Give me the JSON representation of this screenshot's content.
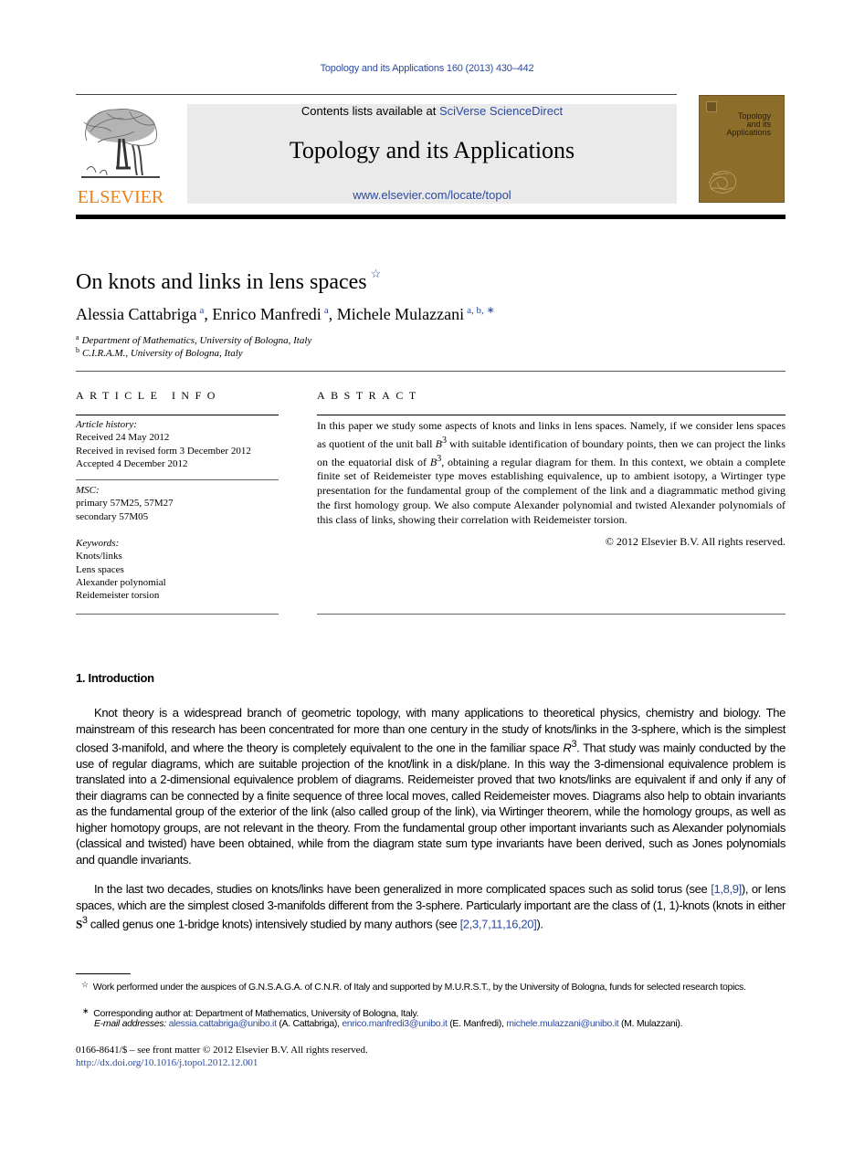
{
  "header": {
    "journal_reference": "Topology and its Applications 160 (2013) 430–442",
    "contents_prefix": "Contents lists available at ",
    "contents_link": "SciVerse ScienceDirect",
    "journal_title": "Topology and its Applications",
    "journal_url": "www.elsevier.com/locate/topol",
    "publisher_logo_text": "ELSEVIER",
    "cover_title_lines": [
      "Topology",
      "and its",
      "Applications"
    ],
    "colors": {
      "link": "#2b4a9f",
      "elsevier_orange": "#f07f1a",
      "cover": "#8c6d2a",
      "masthead_bg": "#eaeaea"
    }
  },
  "article": {
    "title": "On knots and links in lens spaces",
    "title_note_mark": "☆",
    "authors": [
      {
        "name": "Alessia Cattabriga",
        "affil": "a"
      },
      {
        "name": "Enrico Manfredi",
        "affil": "a"
      },
      {
        "name": "Michele Mulazzani",
        "affil": "a, b, ∗"
      }
    ],
    "author_separator": ", ",
    "affiliations": [
      {
        "mark": "a",
        "text": "Department of Mathematics, University of Bologna, Italy"
      },
      {
        "mark": "b",
        "text": "C.I.R.A.M., University of Bologna, Italy"
      }
    ]
  },
  "article_info": {
    "heading": "ARTICLE INFO",
    "history_label": "Article history:",
    "history": [
      "Received 24 May 2012",
      "Received in revised form 3 December 2012",
      "Accepted 4 December 2012"
    ],
    "msc_label": "MSC:",
    "msc": [
      "primary 57M25, 57M27",
      "secondary 57M05"
    ],
    "keywords_label": "Keywords:",
    "keywords": [
      "Knots/links",
      "Lens spaces",
      "Alexander polynomial",
      "Reidemeister torsion"
    ]
  },
  "abstract": {
    "heading": "ABSTRACT",
    "text_1": "In this paper we study some aspects of knots and links in lens spaces. Namely, if we consider lens spaces as quotient of the unit ball ",
    "math_B": "B",
    "math_exp": "3",
    "text_2": " with suitable identification of boundary points, then we can project the links on the equatorial disk of ",
    "text_3": ", obtaining a regular diagram for them. In this context, we obtain a complete finite set of Reidemeister type moves establishing equivalence, up to ambient isotopy, a Wirtinger type presentation for the fundamental group of the complement of the link and a diagrammatic method giving the first homology group. We also compute Alexander polynomial and twisted Alexander polynomials of this class of links, showing their correlation with Reidemeister torsion.",
    "copyright": "© 2012 Elsevier B.V. All rights reserved."
  },
  "introduction": {
    "heading": "1. Introduction",
    "para1_a": "Knot theory is a widespread branch of geometric topology, with many applications to theoretical physics, chemistry and biology. The mainstream of this research has been concentrated for more than one century in the study of knots/links in the 3-sphere, which is the simplest closed 3-manifold, and where the theory is completely equivalent to the one in the familiar space ",
    "para1_R": "R",
    "para1_exp": "3",
    "para1_b": ". That study was mainly conducted by the use of regular diagrams, which are suitable projection of the knot/link in a disk/plane. In this way the 3-dimensional equivalence problem is translated into a 2-dimensional equivalence problem of diagrams. Reidemeister proved that two knots/links are equivalent if and only if any of their diagrams can be connected by a finite sequence of three local moves, called Reidemeister moves. Diagrams also help to obtain invariants as the fundamental group of the exterior of the link (also called group of the link), via Wirtinger theorem, while the homology groups, as well as higher homotopy groups, are not relevant in the theory. From the fundamental group other important invariants such as Alexander polynomials (classical and twisted) have been obtained, while from the diagram state sum type invariants have been derived, such as Jones polynomials and quandle invariants.",
    "para2_a": "In the last two decades, studies on knots/links have been generalized in more complicated spaces such as solid torus (see ",
    "para2_ref1": "[1,8,9]",
    "para2_b": "), or lens spaces, which are the simplest closed 3-manifolds different from the 3-sphere. Particularly important are the class of (1, 1)-knots (knots in either ",
    "para2_S": "S",
    "para2_exp": "3",
    "para2_c": " called genus one 1-bridge knots) intensively studied by many authors (see ",
    "para2_ref2": "[2,3,7,11,16,20]",
    "para2_d": ")."
  },
  "footnotes": {
    "star_mark": "☆",
    "star_text": "Work performed under the auspices of G.N.S.A.G.A. of C.N.R. of Italy and supported by M.U.R.S.T., by the University of Bologna, funds for selected research topics.",
    "corr_mark": "∗",
    "corr_text": "Corresponding author at: Department of Mathematics, University of Bologna, Italy.",
    "email_label": "E-mail addresses:",
    "emails": [
      {
        "address": "alessia.cattabriga@unibo.it",
        "name": "(A. Cattabriga)"
      },
      {
        "address": "enrico.manfredi3@unibo.it",
        "name": "(E. Manfredi)"
      },
      {
        "address": "michele.mulazzani@unibo.it",
        "name": "(M. Mulazzani)."
      }
    ]
  },
  "footer": {
    "front_matter": "0166-8641/$ – see front matter © 2012 Elsevier B.V. All rights reserved.",
    "doi": "http://dx.doi.org/10.1016/j.topol.2012.12.001"
  }
}
